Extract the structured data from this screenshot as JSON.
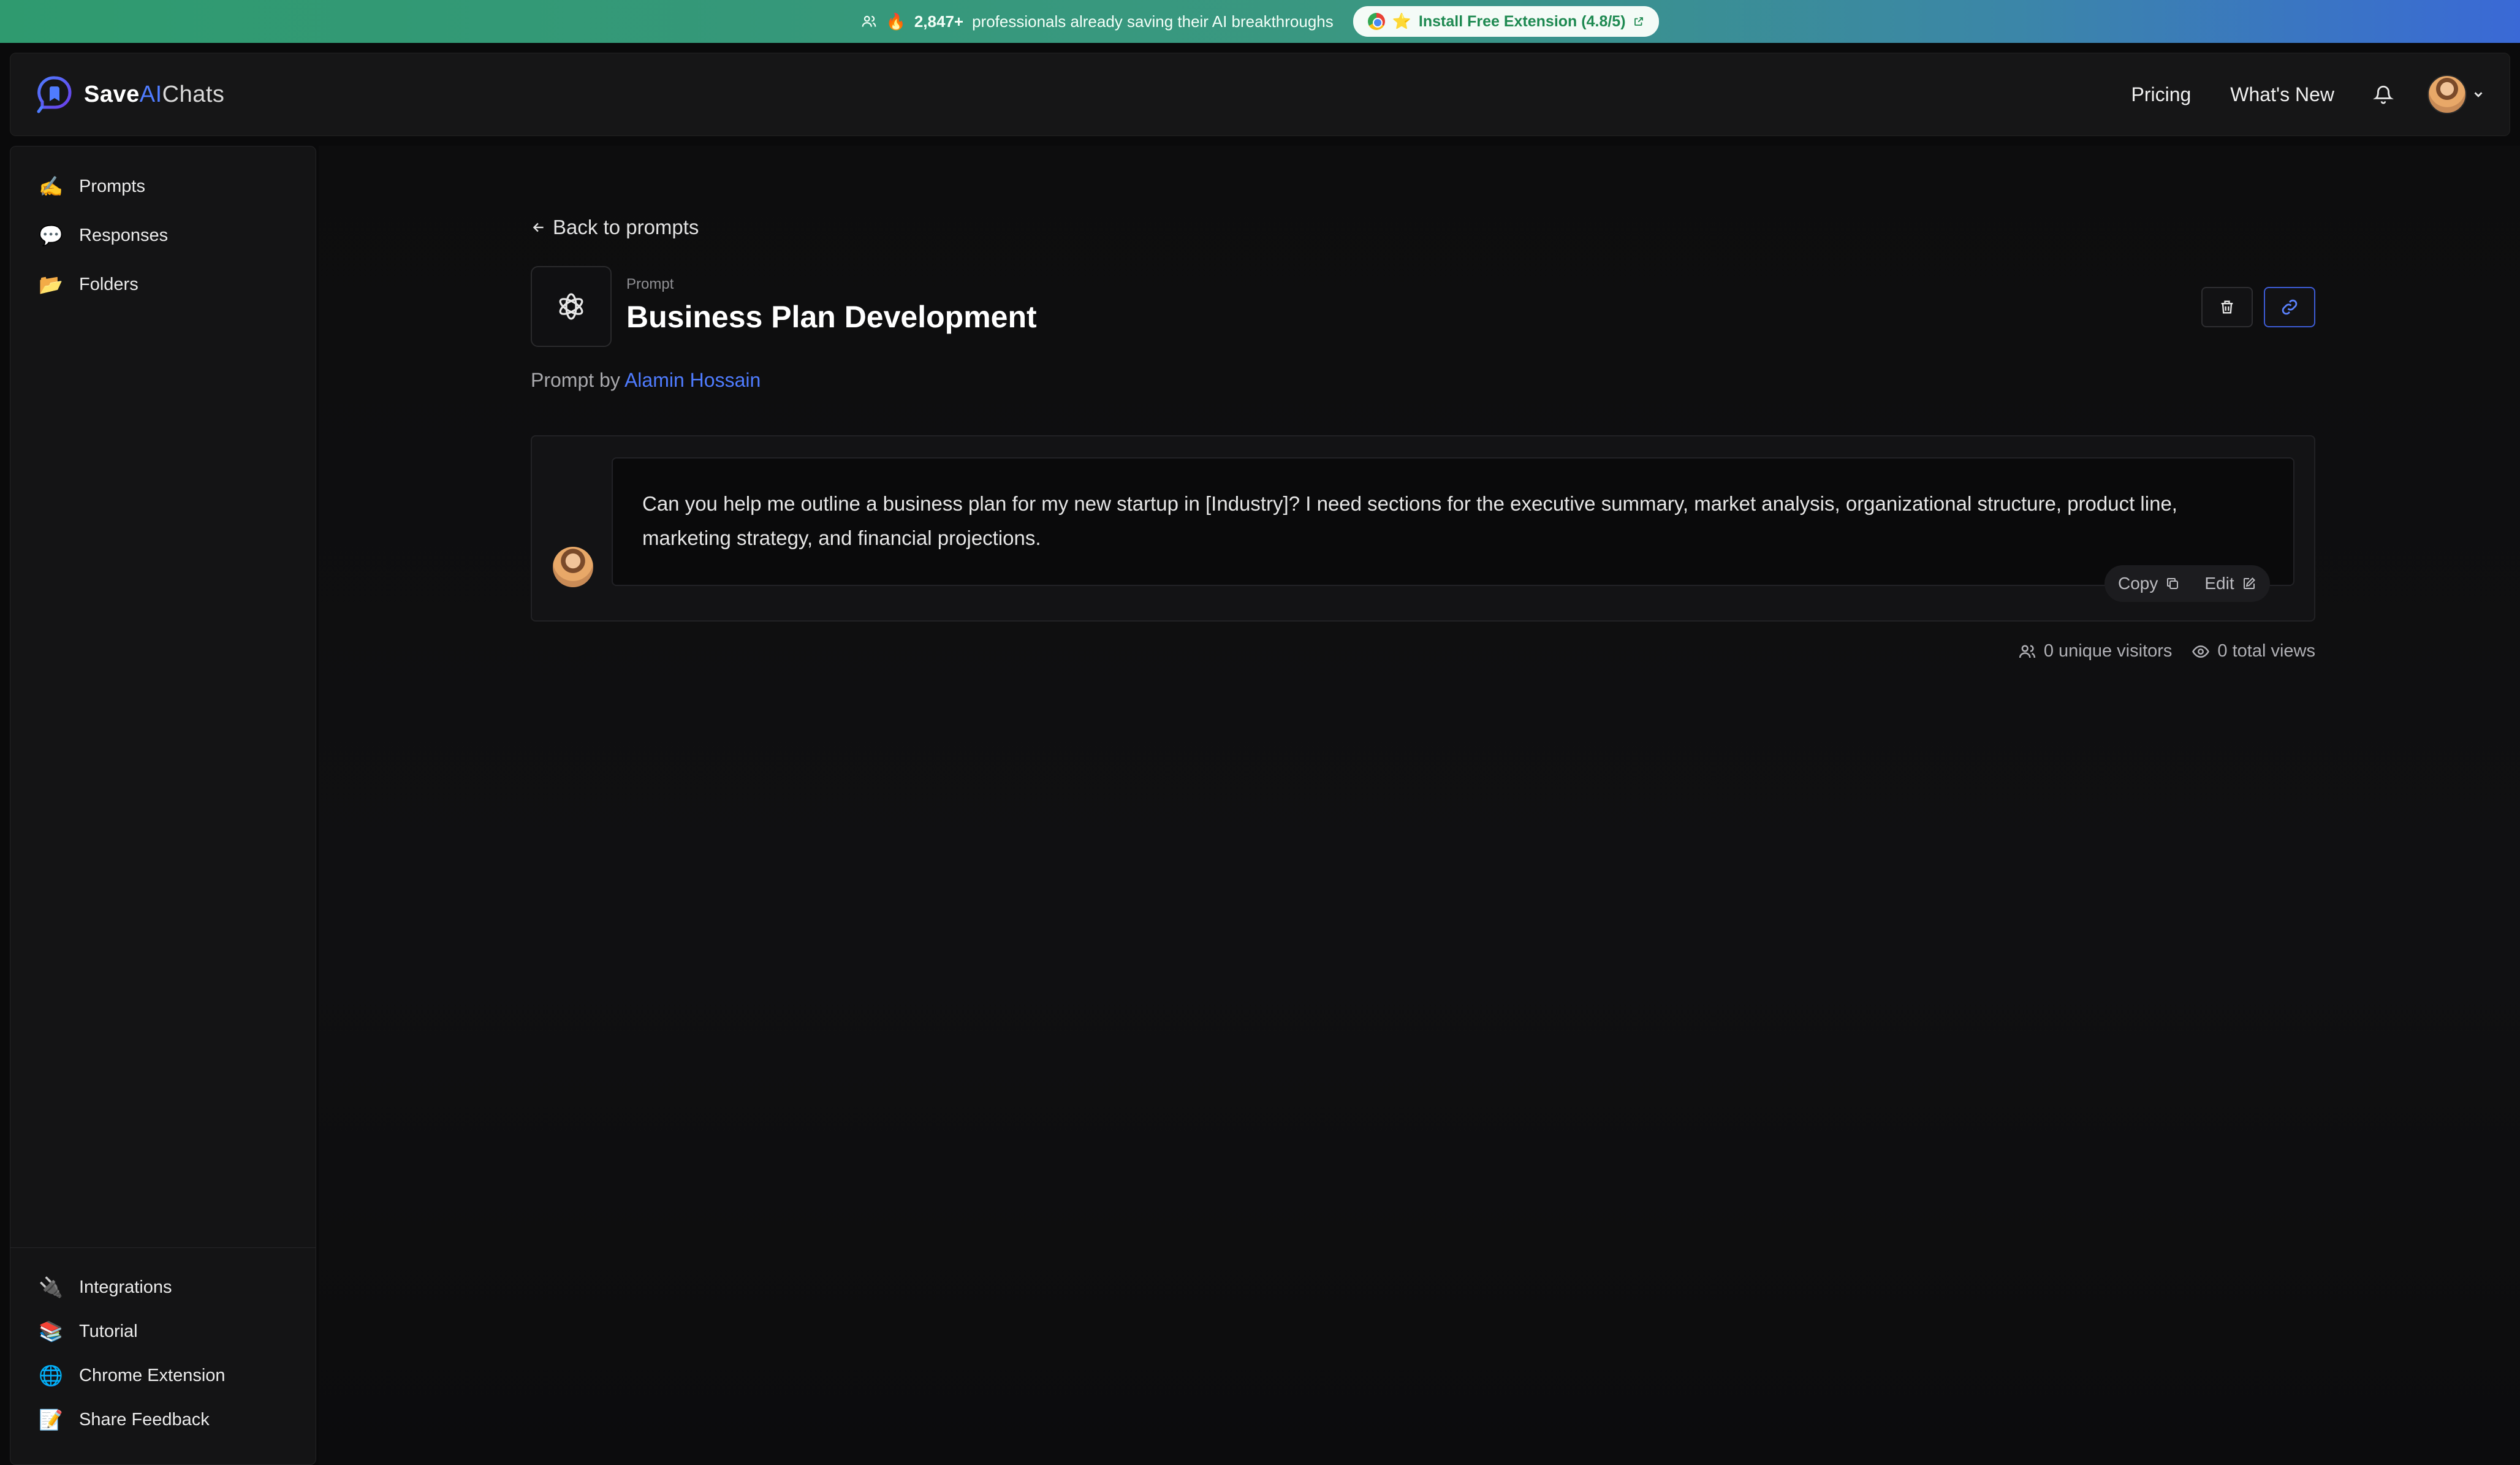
{
  "banner": {
    "prefix": "🔥",
    "count": "2,847+",
    "message": "professionals already saving their AI breakthroughs",
    "cta_star": "⭐",
    "cta_label": "Install Free Extension (4.8/5)"
  },
  "header": {
    "logo_save": "Save",
    "logo_ai": "AI",
    "logo_chats": "Chats",
    "nav": [
      "Pricing",
      "What's New"
    ]
  },
  "sidebar": {
    "top_items": [
      {
        "emoji": "✍️",
        "label": "Prompts"
      },
      {
        "emoji": "💬",
        "label": "Responses"
      },
      {
        "emoji": "📂",
        "label": "Folders"
      }
    ],
    "bottom_items": [
      {
        "emoji": "🔌",
        "label": "Integrations"
      },
      {
        "emoji": "📚",
        "label": "Tutorial"
      },
      {
        "emoji": "🌐",
        "label": "Chrome Extension"
      },
      {
        "emoji": "📝",
        "label": "Share Feedback"
      }
    ]
  },
  "main": {
    "back_label": "Back to prompts",
    "kicker": "Prompt",
    "title": "Business Plan Development",
    "byline_prefix": "Prompt by",
    "author": "Alamin Hossain",
    "prompt_text": "Can you help me outline a business plan for my new startup in [Industry]? I need sections for the executive summary, market analysis, organizational structure, product line, marketing strategy, and financial projections.",
    "copy_label": "Copy",
    "edit_label": "Edit",
    "unique_visitors": "0 unique visitors",
    "total_views": "0 total views"
  },
  "colors": {
    "accent": "#4f7cff",
    "background": "#0a0a0b",
    "banner_start": "#2f9a6f",
    "banner_end": "#3a69d6"
  }
}
